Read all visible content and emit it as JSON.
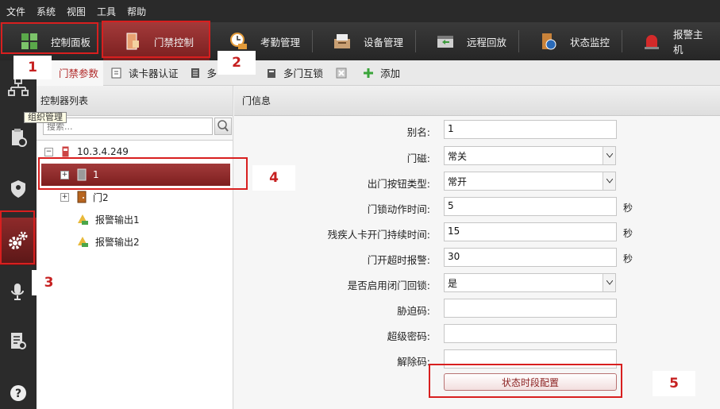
{
  "menu": [
    "文件",
    "系统",
    "视图",
    "工具",
    "帮助"
  ],
  "toolbar": [
    {
      "label": "控制面板",
      "icon": "grid-icon"
    },
    {
      "label": "门禁控制",
      "icon": "door-lock-icon",
      "active": true
    },
    {
      "label": "考勤管理",
      "icon": "attendance-clock-icon"
    },
    {
      "label": "设备管理",
      "icon": "device-icon"
    },
    {
      "label": "远程回放",
      "icon": "playback-icon"
    },
    {
      "label": "状态监控",
      "icon": "status-monitor-icon"
    },
    {
      "label": "报警主机",
      "icon": "alarm-host-icon"
    }
  ],
  "subtabs": [
    "门禁参数",
    "读卡器认证",
    "多",
    "多门互锁",
    "添加"
  ],
  "tooltip": "组织管理",
  "tree": {
    "title": "控制器列表",
    "search_placeholder": "搜索...",
    "nodes": [
      "10.3.4.249",
      "1",
      "门2",
      "报警输出1",
      "报警输出2"
    ]
  },
  "form": {
    "title": "门信息",
    "labels": [
      "别名:",
      "门磁:",
      "出门按钮类型:",
      "门锁动作时间:",
      "残疾人卡开门持续时间:",
      "门开超时报警:",
      "是否启用闭门回锁:",
      "胁迫码:",
      "超级密码:",
      "解除码:"
    ],
    "alias": "1",
    "door_sensor": "常关",
    "exit_button_type": "常开",
    "lock_action_time": "5",
    "disabled_card_duration": "15",
    "open_timeout_alarm": "30",
    "close_relock": "是",
    "duress_code": "",
    "super_password": "",
    "dismiss_code": "",
    "unit": "秒",
    "state_button": "状态时段配置"
  },
  "annotations": [
    "1",
    "2",
    "3",
    "4",
    "5"
  ],
  "colors": {
    "accent": "#b12a2a",
    "annotation": "#d81f1f"
  }
}
